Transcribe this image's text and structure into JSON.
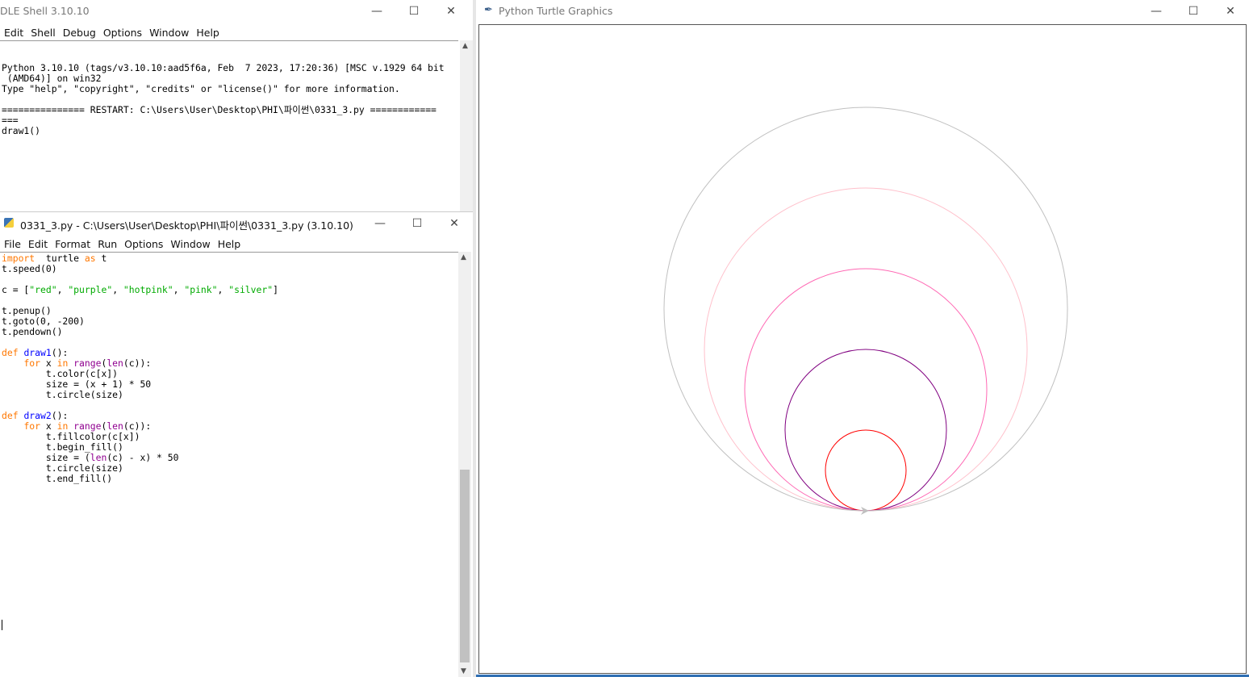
{
  "shell": {
    "title": "DLE Shell 3.10.10",
    "menu": [
      "Edit",
      "Shell",
      "Debug",
      "Options",
      "Window",
      "Help"
    ],
    "lines": [
      "Python 3.10.10 (tags/v3.10.10:aad5f6a, Feb  7 2023, 17:20:36) [MSC v.1929 64 bit",
      " (AMD64)] on win32",
      "Type \"help\", \"copyright\", \"credits\" or \"license()\" for more information.",
      "",
      "=============== RESTART: C:\\Users\\User\\Desktop\\PHI\\파이썬\\0331_3.py ============",
      "===",
      "draw1()"
    ]
  },
  "editor": {
    "title": "0331_3.py - C:\\Users\\User\\Desktop\\PHI\\파이썬\\0331_3.py (3.10.10)",
    "menu": [
      "File",
      "Edit",
      "Format",
      "Run",
      "Options",
      "Window",
      "Help"
    ],
    "code": [
      [
        [
          "kw",
          "import"
        ],
        [
          "",
          "  turtle "
        ],
        [
          "kw",
          "as"
        ],
        [
          "",
          " t"
        ]
      ],
      [
        [
          "",
          "t.speed(0)"
        ]
      ],
      [],
      [
        [
          "",
          "c = ["
        ],
        [
          "st",
          "\"red\""
        ],
        [
          "",
          ", "
        ],
        [
          "st",
          "\"purple\""
        ],
        [
          "",
          ", "
        ],
        [
          "st",
          "\"hotpink\""
        ],
        [
          "",
          ", "
        ],
        [
          "st",
          "\"pink\""
        ],
        [
          "",
          ", "
        ],
        [
          "st",
          "\"silver\""
        ],
        [
          "",
          "]"
        ]
      ],
      [],
      [
        [
          "",
          "t.penup()"
        ]
      ],
      [
        [
          "",
          "t.goto(0, -200)"
        ]
      ],
      [
        [
          "",
          "t.pendown()"
        ]
      ],
      [],
      [
        [
          "kw",
          "def"
        ],
        [
          "",
          " "
        ],
        [
          "df",
          "draw1"
        ],
        [
          "",
          "():"
        ]
      ],
      [
        [
          "",
          "    "
        ],
        [
          "kw",
          "for"
        ],
        [
          "",
          " x "
        ],
        [
          "kw",
          "in"
        ],
        [
          "",
          " "
        ],
        [
          "bi",
          "range"
        ],
        [
          "",
          "("
        ],
        [
          "bi",
          "len"
        ],
        [
          "",
          "(c)):"
        ]
      ],
      [
        [
          "",
          "        t.color(c[x])"
        ]
      ],
      [
        [
          "",
          "        size = (x + 1) * 50"
        ]
      ],
      [
        [
          "",
          "        t.circle(size)"
        ]
      ],
      [],
      [
        [
          "kw",
          "def"
        ],
        [
          "",
          " "
        ],
        [
          "df",
          "draw2"
        ],
        [
          "",
          "():"
        ]
      ],
      [
        [
          "",
          "    "
        ],
        [
          "kw",
          "for"
        ],
        [
          "",
          " x "
        ],
        [
          "kw",
          "in"
        ],
        [
          "",
          " "
        ],
        [
          "bi",
          "range"
        ],
        [
          "",
          "("
        ],
        [
          "bi",
          "len"
        ],
        [
          "",
          "(c)):"
        ]
      ],
      [
        [
          "",
          "        t.fillcolor(c[x])"
        ]
      ],
      [
        [
          "",
          "        t.begin_fill()"
        ]
      ],
      [
        [
          "",
          "        size = ("
        ],
        [
          "bi",
          "len"
        ],
        [
          "",
          "(c) - x) * 50"
        ]
      ],
      [
        [
          "",
          "        t.circle(size)"
        ]
      ],
      [
        [
          "",
          "        t.end_fill()"
        ]
      ]
    ]
  },
  "turtle": {
    "title": "Python Turtle Graphics",
    "circles": [
      {
        "color": "#ff0000",
        "radius": 50
      },
      {
        "color": "#800080",
        "radius": 100
      },
      {
        "color": "#ff69b4",
        "radius": 150
      },
      {
        "color": "#ffc0cb",
        "radius": 200
      },
      {
        "color": "#c0c0c0",
        "radius": 250
      }
    ],
    "start": [
      0,
      -200
    ],
    "cursor_color": "#c0c0c0"
  },
  "window_buttons": {
    "minimize": "—",
    "maximize": "☐",
    "close": "✕"
  }
}
